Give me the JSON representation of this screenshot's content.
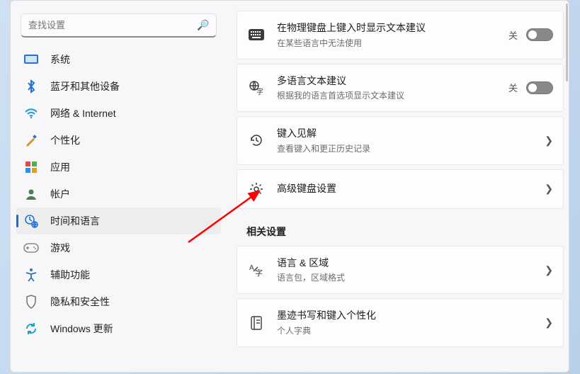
{
  "search": {
    "placeholder": "查找设置"
  },
  "nav": [
    {
      "label": "系统",
      "icon": "system",
      "color": "#1e74d6",
      "active": false
    },
    {
      "label": "蓝牙和其他设备",
      "icon": "bluetooth",
      "color": "#1e74d6",
      "active": false
    },
    {
      "label": "网络 & Internet",
      "icon": "wifi",
      "color": "#1e9ad6",
      "active": false
    },
    {
      "label": "个性化",
      "icon": "brush",
      "color": "#4c8de0",
      "active": false
    },
    {
      "label": "应用",
      "icon": "apps",
      "color": "#6a6a6a",
      "active": false
    },
    {
      "label": "帐户",
      "icon": "person",
      "color": "#4e7c54",
      "active": false
    },
    {
      "label": "时间和语言",
      "icon": "clock-globe",
      "color": "#1e74d6",
      "active": true
    },
    {
      "label": "游戏",
      "icon": "gamepad",
      "color": "#8c8c8c",
      "active": false
    },
    {
      "label": "辅助功能",
      "icon": "accessibility",
      "color": "#2f6fb7",
      "active": false
    },
    {
      "label": "隐私和安全性",
      "icon": "shield",
      "color": "#7a7a7a",
      "active": false
    },
    {
      "label": "Windows 更新",
      "icon": "update",
      "color": "#1fa2c4",
      "active": false
    }
  ],
  "section_related": "相关设置",
  "cards": [
    {
      "title": "在物理键盘上键入时显示文本建议",
      "sub": "在某些语言中无法使用",
      "state": "关"
    },
    {
      "title": "多语言文本建议",
      "sub": "根据我的语言首选项显示文本建议",
      "state": "关"
    },
    {
      "title": "键入见解",
      "sub": "查看键入和更正历史记录"
    },
    {
      "title": "高级键盘设置"
    },
    {
      "title": "语言 & 区域",
      "sub": "语言包，区域格式"
    },
    {
      "title": "墨迹书写和键入个性化",
      "sub": "个人字典"
    }
  ]
}
